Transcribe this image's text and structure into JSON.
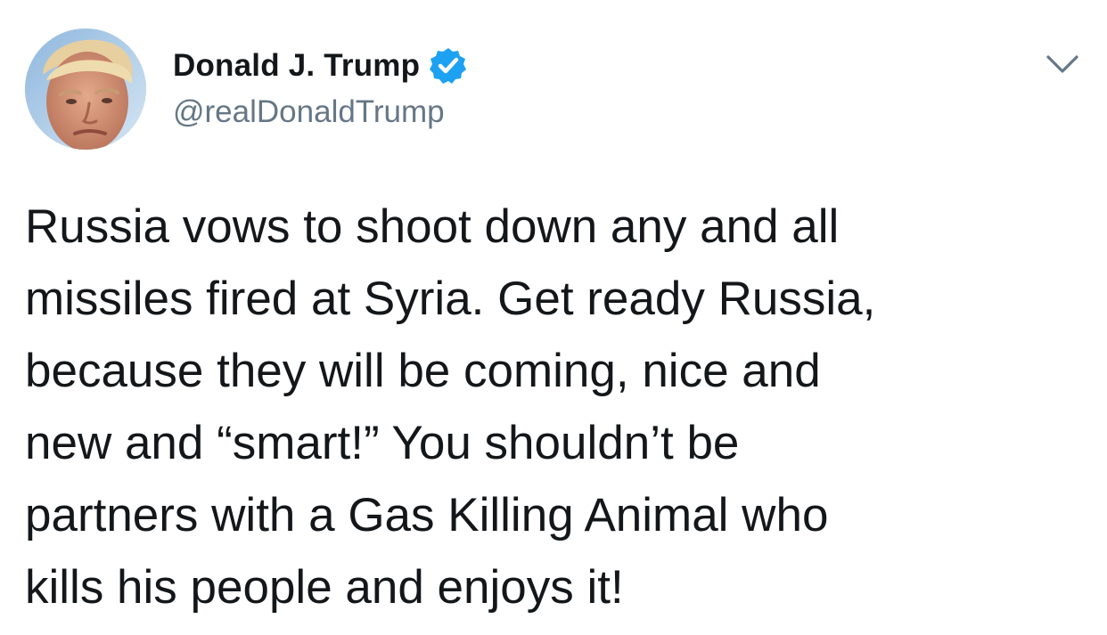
{
  "tweet": {
    "author": {
      "display_name": "Donald J. Trump",
      "handle": "@realDonaldTrump",
      "verified": true,
      "avatar_icon": "profile-photo"
    },
    "menu_icon": "chevron-down-icon",
    "text": "Russia vows to shoot down any and all\nmissiles fired at Syria. Get ready Russia,\nbecause they will be coming, nice and\nnew and “smart!” You shouldn’t be\npartners with a Gas Killing Animal who\nkills his people and enjoys it!"
  },
  "colors": {
    "text": "#14171a",
    "secondary_text": "#657786",
    "verified_badge": "#1da1f2",
    "background": "#ffffff"
  }
}
